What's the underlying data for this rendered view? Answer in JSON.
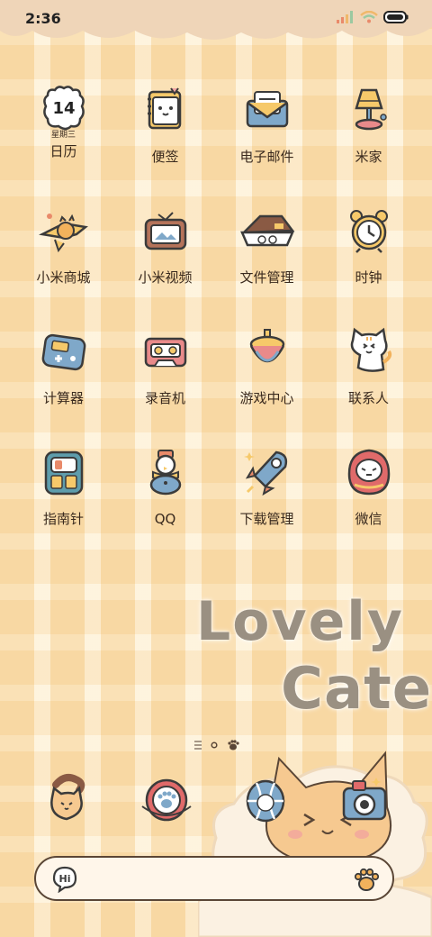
{
  "status_bar": {
    "time": "2:36"
  },
  "apps": [
    {
      "name": "calendar",
      "label": "日历",
      "icon_text": "14",
      "icon_sub": "星期三"
    },
    {
      "name": "notes",
      "label": "便签"
    },
    {
      "name": "email",
      "label": "电子邮件"
    },
    {
      "name": "mijia",
      "label": "米家"
    },
    {
      "name": "mi-store",
      "label": "小米商城"
    },
    {
      "name": "mi-video",
      "label": "小米视频"
    },
    {
      "name": "file-manager",
      "label": "文件管理"
    },
    {
      "name": "clock",
      "label": "时钟"
    },
    {
      "name": "calculator",
      "label": "计算器"
    },
    {
      "name": "recorder",
      "label": "录音机"
    },
    {
      "name": "game-center",
      "label": "游戏中心"
    },
    {
      "name": "contacts",
      "label": "联系人"
    },
    {
      "name": "compass",
      "label": "指南针"
    },
    {
      "name": "qq",
      "label": "QQ"
    },
    {
      "name": "downloads",
      "label": "下载管理"
    },
    {
      "name": "wechat",
      "label": "微信"
    }
  ],
  "wallpaper": {
    "line1": "Lovely",
    "line2": "Cate"
  },
  "search": {
    "hi_label": "Hi"
  },
  "colors": {
    "outline": "#5a4636",
    "accent": "#f5b860",
    "background": "#fdeed2"
  }
}
